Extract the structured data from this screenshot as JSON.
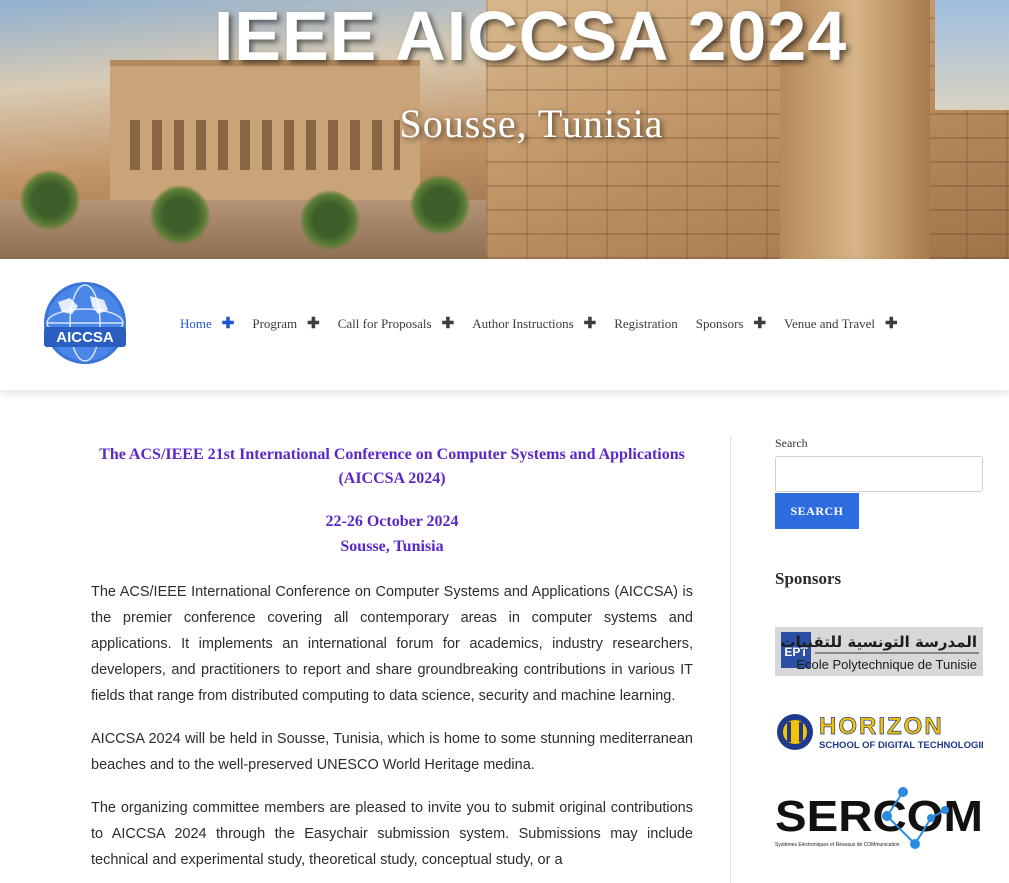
{
  "hero": {
    "title": "IEEE AICCSA 2024",
    "subtitle": "Sousse, Tunisia"
  },
  "logo": {
    "text": "AICCSA"
  },
  "nav": {
    "items": [
      {
        "label": "Home",
        "has_submenu": true,
        "active": true
      },
      {
        "label": "Program",
        "has_submenu": true
      },
      {
        "label": "Call for Proposals",
        "has_submenu": true
      },
      {
        "label": "Author Instructions",
        "has_submenu": true
      },
      {
        "label": "Registration",
        "has_submenu": false
      },
      {
        "label": "Sponsors",
        "has_submenu": true
      },
      {
        "label": "Venue and Travel",
        "has_submenu": true
      }
    ]
  },
  "main": {
    "title": "The ACS/IEEE 21st International Conference on Computer Systems and Applications (AICCSA 2024)",
    "date": "22-26 October 2024",
    "location": "Sousse, Tunisia",
    "paragraphs": [
      "The ACS/IEEE International Conference on Computer Systems and Applications (AICCSA) is the premier conference covering all contemporary areas in computer systems and applications. It implements an international forum for academics, industry researchers, developers, and practitioners to report and share groundbreaking contributions in various IT fields that range from distributed computing to data science, security and machine learning.",
      "AICCSA 2024 will be held in Sousse, Tunisia, which is home to some stunning mediterranean beaches and to the well-preserved UNESCO World Heritage medina.",
      "The organizing committee members are pleased to invite you to submit original contributions to AICCSA 2024 through the Easychair submission system. Submissions may include technical and experimental study, theoretical study, conceptual study, or a"
    ]
  },
  "sidebar": {
    "search_label": "Search",
    "search_value": "",
    "search_button": "SEARCH",
    "sponsors_title": "Sponsors",
    "sponsors": {
      "ept_arabic": "المدرسة التونسية للتقنيات",
      "ept_logo": "EPT",
      "ept_name": "Ecole Polytechnique de Tunisie",
      "horizon_name": "HORIZON",
      "horizon_sub": "SCHOOL OF DIGITAL TECHNOLOGIES",
      "seram_name": "SERCOM",
      "seram_sub": "Systèmes Electroniques et Réseaux de COMmunication"
    }
  },
  "colors": {
    "accent": "#2255d6",
    "heading": "#5a28c9",
    "button": "#2d6cdf"
  }
}
